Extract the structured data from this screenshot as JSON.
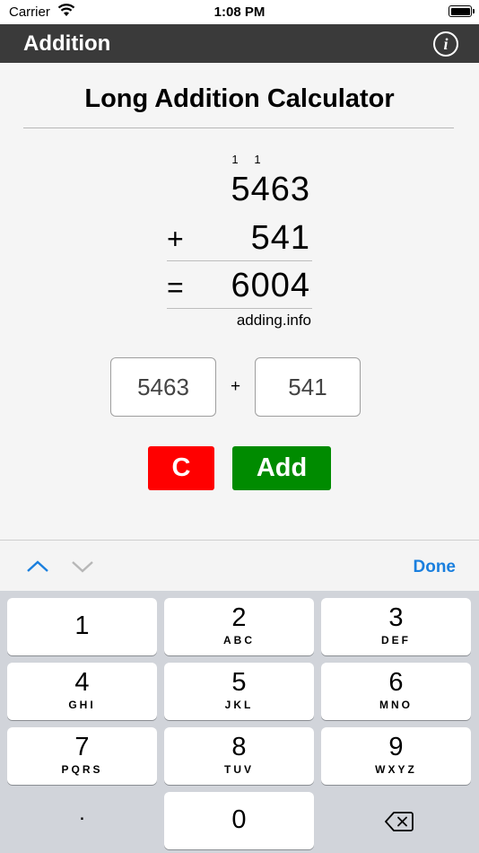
{
  "status_bar": {
    "carrier": "Carrier",
    "time": "1:08 PM"
  },
  "navbar": {
    "title": "Addition",
    "info_label": "i"
  },
  "heading": "Long Addition Calculator",
  "calculation": {
    "carries": [
      "1",
      "1"
    ],
    "first_number": "5463",
    "operator": "+",
    "second_number": "541",
    "equals": "=",
    "result": "6004",
    "credit": "adding.info"
  },
  "inputs": {
    "first_value": "5463",
    "plus": "+",
    "second_value": "541"
  },
  "buttons": {
    "clear": "C",
    "add": "Add",
    "clear_color": "#ff0000",
    "add_color": "#008b00"
  },
  "accessory": {
    "done": "Done",
    "accent_color": "#1a7fde"
  },
  "keypad": {
    "keys": [
      {
        "digit": "1",
        "letters": ""
      },
      {
        "digit": "2",
        "letters": "ABC"
      },
      {
        "digit": "3",
        "letters": "DEF"
      },
      {
        "digit": "4",
        "letters": "GHI"
      },
      {
        "digit": "5",
        "letters": "JKL"
      },
      {
        "digit": "6",
        "letters": "MNO"
      },
      {
        "digit": "7",
        "letters": "PQRS"
      },
      {
        "digit": "8",
        "letters": "TUV"
      },
      {
        "digit": "9",
        "letters": "WXYZ"
      },
      {
        "digit": "0",
        "letters": ""
      }
    ],
    "dot": ".",
    "delete_icon": "delete-backspace-icon"
  }
}
